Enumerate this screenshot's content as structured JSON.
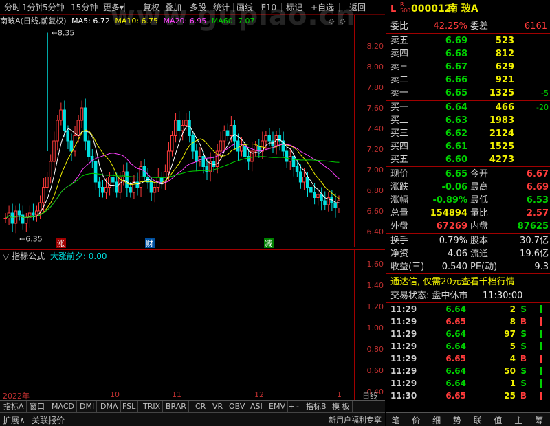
{
  "toolbar": {
    "items": [
      "分时",
      "1分钟",
      "5分钟",
      "15分钟",
      "更多▾",
      "复权",
      "叠加",
      "多股",
      "统计",
      "画线",
      "F10",
      "标记",
      "+自选",
      "返回"
    ]
  },
  "watermark": "www.gupiao.cn",
  "kline_info": {
    "title": "南玻A(日线,前复权)",
    "ma5": "MA5: 6.72",
    "ma10": "MA10: 6.75",
    "ma20": "MA20: 6.95",
    "ma60": "MA60: 7.07",
    "high_mark": "8.35",
    "low_mark": "6.35",
    "markers": [
      "涨",
      "财",
      "减"
    ]
  },
  "price_axis": [
    "8.20",
    "8.00",
    "7.80",
    "7.60",
    "7.40",
    "7.20",
    "7.00",
    "6.80",
    "6.60",
    "6.40"
  ],
  "indicator": {
    "name": "指标公式",
    "label": "大涨前夕: 0.00",
    "axis": [
      "1.60",
      "1.40",
      "1.20",
      "1.00",
      "0.80",
      "0.60",
      "0.40",
      "0.20"
    ]
  },
  "date_axis": [
    "2022年",
    "10",
    "11",
    "12",
    "1"
  ],
  "cycle": "日线",
  "tabs": [
    "指标A",
    "窗口",
    "MACD",
    "DMI",
    "DMA",
    "FSL",
    "TRIX",
    "BRAR",
    "CR",
    "VR",
    "OBV",
    "ASI",
    "EMV",
    "指标B",
    "模 板"
  ],
  "tab_arrows": [
    "+",
    "-"
  ],
  "bottombar": {
    "left1": "扩展∧",
    "left2": "关联报价",
    "right": "新用户福利专享"
  },
  "quote": {
    "header_flag": "L",
    "header_sub": "R 500",
    "code": "000012",
    "name": "南 玻A",
    "weibi_label": "委比",
    "weibi": "42.25%",
    "weicha_label": "委差",
    "weicha": "6161",
    "asks": [
      {
        "label": "卖五",
        "price": "6.69",
        "vol": "523",
        "chg": ""
      },
      {
        "label": "卖四",
        "price": "6.68",
        "vol": "812",
        "chg": ""
      },
      {
        "label": "卖三",
        "price": "6.67",
        "vol": "629",
        "chg": ""
      },
      {
        "label": "卖二",
        "price": "6.66",
        "vol": "921",
        "chg": ""
      },
      {
        "label": "卖一",
        "price": "6.65",
        "vol": "1325",
        "chg": "-5"
      }
    ],
    "bids": [
      {
        "label": "买一",
        "price": "6.64",
        "vol": "466",
        "chg": "-20"
      },
      {
        "label": "买二",
        "price": "6.63",
        "vol": "1983",
        "chg": ""
      },
      {
        "label": "买三",
        "price": "6.62",
        "vol": "2124",
        "chg": ""
      },
      {
        "label": "买四",
        "price": "6.61",
        "vol": "1525",
        "chg": ""
      },
      {
        "label": "买五",
        "price": "6.60",
        "vol": "4273",
        "chg": ""
      }
    ],
    "stats": [
      {
        "l1": "现价",
        "v1": "6.65",
        "l2": "今开",
        "v2": "6.67"
      },
      {
        "l1": "涨跌",
        "v1": "-0.06",
        "l2": "最高",
        "v2": "6.69"
      },
      {
        "l1": "涨幅",
        "v1": "-0.89%",
        "l2": "最低",
        "v2": "6.53"
      },
      {
        "l1": "总量",
        "v1": "154894",
        "l2": "量比",
        "v2": "2.57"
      },
      {
        "l1": "外盘",
        "v1": "67269",
        "l2": "内盘",
        "v2": "87625"
      }
    ],
    "fund": [
      {
        "l1": "换手",
        "v1": "0.79%",
        "l2": "股本",
        "v2": "30.7亿"
      },
      {
        "l1": "净资",
        "v1": "4.06",
        "l2": "流通",
        "v2": "19.6亿"
      },
      {
        "l1": "收益(三)",
        "v1": "0.540",
        "l2": "PE(动)",
        "v2": "9.3"
      }
    ],
    "promo": "通达信, 仅需20元查看千档行情",
    "status_label": "交易状态: 盘中休市",
    "status_time": "11:30:00",
    "ticks": [
      {
        "t": "11:29",
        "p": "6.64",
        "v": "2",
        "s": "S"
      },
      {
        "t": "11:29",
        "p": "6.65",
        "v": "8",
        "s": "B"
      },
      {
        "t": "11:29",
        "p": "6.64",
        "v": "97",
        "s": "S"
      },
      {
        "t": "11:29",
        "p": "6.64",
        "v": "5",
        "s": "S"
      },
      {
        "t": "11:29",
        "p": "6.65",
        "v": "4",
        "s": "B"
      },
      {
        "t": "11:29",
        "p": "6.64",
        "v": "50",
        "s": "S"
      },
      {
        "t": "11:29",
        "p": "6.64",
        "v": "1",
        "s": "S"
      },
      {
        "t": "11:30",
        "p": "6.65",
        "v": "25",
        "s": "B"
      }
    ],
    "bottom_tabs": [
      "笔",
      "价",
      "细",
      "势",
      "联",
      "值",
      "主",
      "筹"
    ]
  },
  "colors": {
    "up": "#ff3b3b",
    "down": "#00e0e0",
    "ma5": "#ffffff",
    "ma10": "#f0f000",
    "ma20": "#ff40ff",
    "ma60": "#00d000"
  }
}
